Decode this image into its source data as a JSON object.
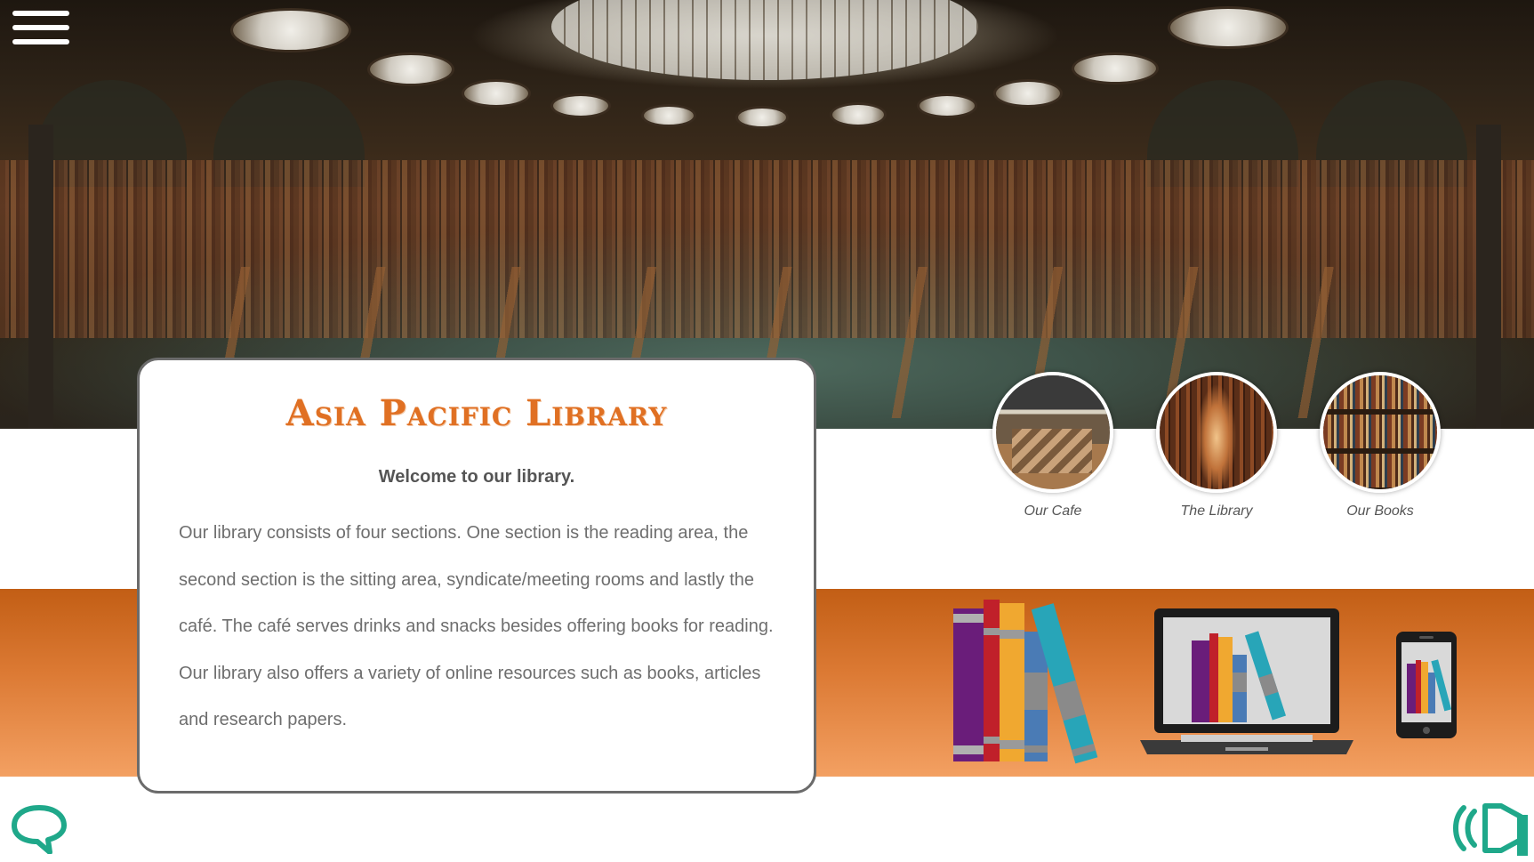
{
  "header": {
    "menu_icon": "hamburger-menu-icon"
  },
  "card": {
    "title": "Asia Pacific Library",
    "welcome": "Welcome to our library.",
    "body": "Our library consists of four sections. One section is the reading area, the second section is the sitting area, syndicate/meeting rooms and lastly the café. The café serves drinks and snacks besides offering books for reading. Our library also offers a variety of online resources such as books, articles and research papers."
  },
  "sections": [
    {
      "label": "Our Cafe",
      "icon": "cafe-photo"
    },
    {
      "label": "The Library",
      "icon": "library-photo"
    },
    {
      "label": "Our Books",
      "icon": "books-photo"
    }
  ],
  "footer": {
    "chat_icon": "chat-bubble-icon",
    "audio_icon": "speaker-icon"
  },
  "colors": {
    "title": "#e07023",
    "band_top": "#c25e15",
    "band_bottom": "#f3a062",
    "accent_green": "#1fa88a"
  }
}
